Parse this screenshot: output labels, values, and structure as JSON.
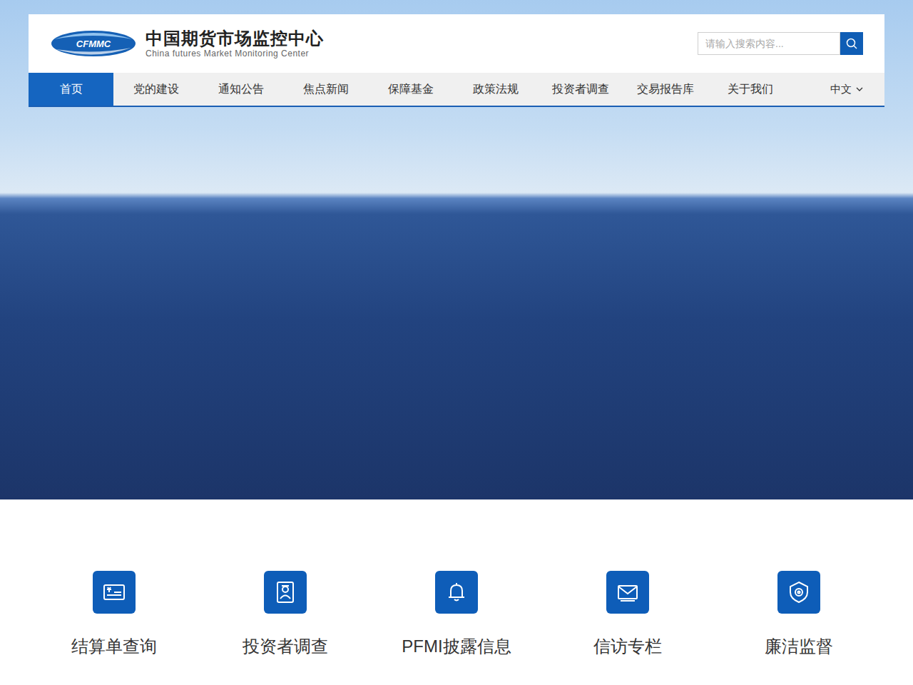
{
  "logo": {
    "mark": "CFMMC",
    "title": "中国期货市场监控中心",
    "subtitle": "China futures Market Monitoring Center"
  },
  "search": {
    "placeholder": "请输入搜索内容..."
  },
  "nav": {
    "items": [
      {
        "label": "首页",
        "selected": true
      },
      {
        "label": "党的建设",
        "selected": false
      },
      {
        "label": "通知公告",
        "selected": false
      },
      {
        "label": "焦点新闻",
        "selected": false
      },
      {
        "label": "保障基金",
        "selected": false
      },
      {
        "label": "政策法规",
        "selected": false
      },
      {
        "label": "投资者调查",
        "selected": false
      },
      {
        "label": "交易报告库",
        "selected": false
      },
      {
        "label": "关于我们",
        "selected": false
      }
    ],
    "language": "中文"
  },
  "quick_links": [
    {
      "label": "结算单查询"
    },
    {
      "label": "投资者调查"
    },
    {
      "label": "PFMI披露信息"
    },
    {
      "label": "信访专栏"
    },
    {
      "label": "廉洁监督"
    }
  ]
}
